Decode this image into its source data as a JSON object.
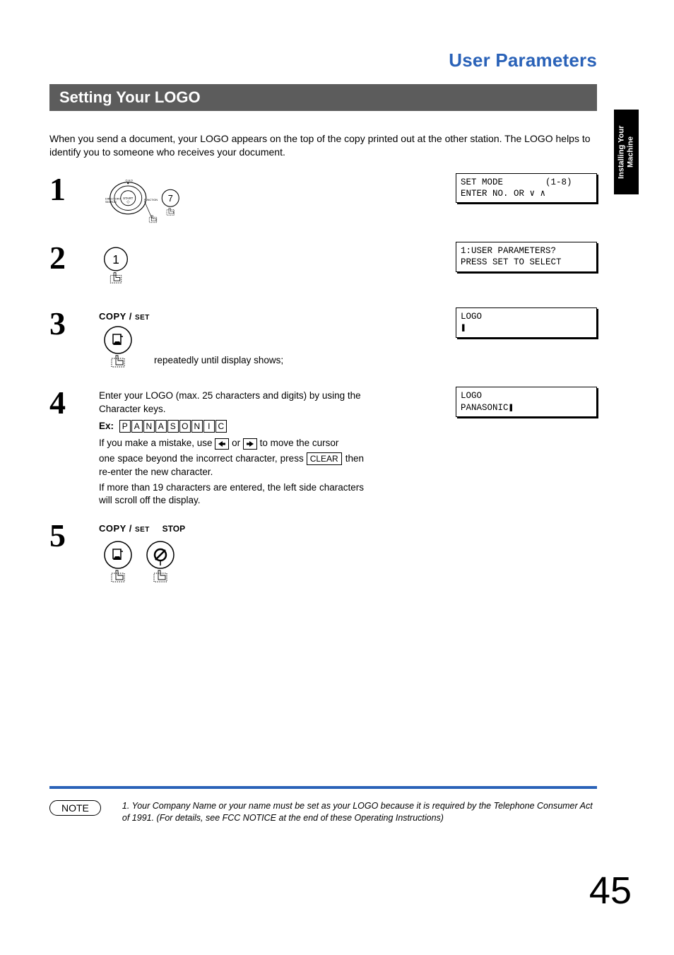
{
  "page_title": "User Parameters",
  "section_heading": "Setting Your LOGO",
  "intro": "When you send a document, your LOGO appears on the top of the copy printed out at the other station. The LOGO helps to identify you to someone who receives your document.",
  "side_tab": "Installing Your\nMachine",
  "steps": {
    "s1": {
      "num": "1",
      "dial_key": "7",
      "lcd_line1": "SET MODE        (1-8)",
      "lcd_line2": "ENTER NO. OR ∨ ∧"
    },
    "s2": {
      "num": "2",
      "key": "1",
      "lcd_line1": "1:USER PARAMETERS?",
      "lcd_line2": "PRESS SET TO SELECT"
    },
    "s3": {
      "num": "3",
      "button_label_main": "COPY / ",
      "button_label_sub": "SET",
      "trail_text": "repeatedly until display shows;",
      "lcd_line1": "LOGO",
      "lcd_line2": "❚"
    },
    "s4": {
      "num": "4",
      "text1": "Enter your LOGO (max. 25 characters and digits) by using the Character keys.",
      "ex_label": "Ex:",
      "ex_keys": [
        "P",
        "A",
        "N",
        "A",
        "S",
        "O",
        "N",
        "I",
        "C"
      ],
      "text2a": "If you make a mistake, use ",
      "text2b": " or ",
      "text2c": " to move the cursor",
      "text3a": "one space beyond the incorrect character, press ",
      "clear_key": "CLEAR",
      "text3b": " then re-enter the new character.",
      "text4": "If more than 19 characters are entered, the left side characters will scroll off the display.",
      "lcd_line1": "LOGO",
      "lcd_line2": "PANASONIC❚"
    },
    "s5": {
      "num": "5",
      "copyset_main": "COPY / ",
      "copyset_sub": "SET",
      "stop_label": "STOP"
    }
  },
  "note": {
    "label": "NOTE",
    "text": "1. Your Company Name or your name must be set as your LOGO because it is required by the Telephone Consumer Act of 1991. (For details, see FCC NOTICE at the end of these Operating Instructions)"
  },
  "page_number": "45"
}
